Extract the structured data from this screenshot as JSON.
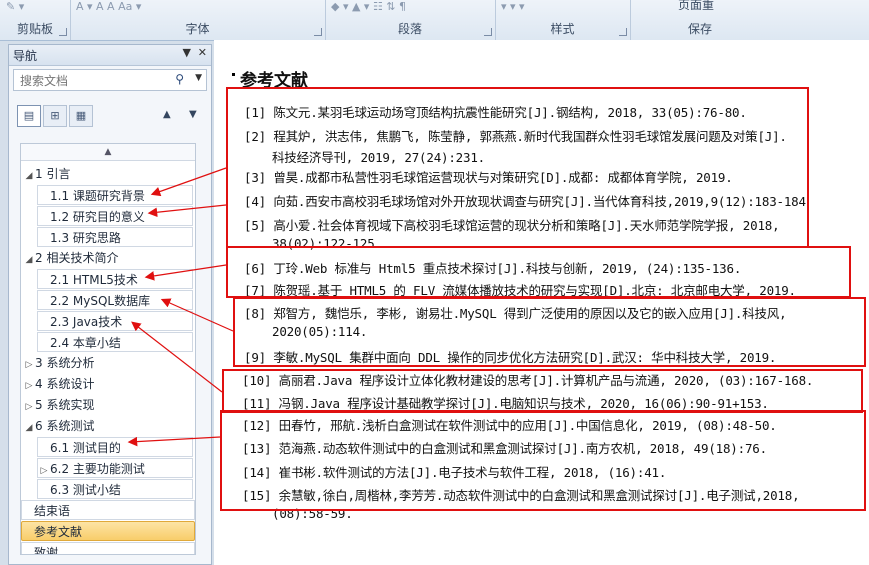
{
  "ribbon": {
    "groups": [
      {
        "label": "剪贴板",
        "icons": "✎ ▾"
      },
      {
        "label": "字体",
        "icons": "A ▾  A  A  Aa ▾"
      },
      {
        "label": "段落",
        "icons": "◆ ▾  ▲ ▾  ☷  ⇅  ¶"
      },
      {
        "label": "样式",
        "icons": "▾  ▾  ▾"
      },
      {
        "label": "页面重",
        "icons": ""
      },
      {
        "label": "保存",
        "icons": ""
      }
    ]
  },
  "nav": {
    "title": "导航",
    "search_placeholder": "搜索文档",
    "items": [
      {
        "label": "1 引言",
        "expander": "◢"
      },
      {
        "label": "1.1 课题研究背景",
        "expander": ""
      },
      {
        "label": "1.2 研究目的意义",
        "expander": ""
      },
      {
        "label": "1.3 研究思路",
        "expander": ""
      },
      {
        "label": "2 相关技术简介",
        "expander": "◢"
      },
      {
        "label": "2.1 HTML5技术",
        "expander": ""
      },
      {
        "label": "2.2 MySQL数据库",
        "expander": ""
      },
      {
        "label": "2.3 Java技术",
        "expander": ""
      },
      {
        "label": "2.4 本章小结",
        "expander": ""
      },
      {
        "label": "3 系统分析",
        "expander": "▷"
      },
      {
        "label": "4 系统设计",
        "expander": "▷"
      },
      {
        "label": "5 系统实现",
        "expander": "▷"
      },
      {
        "label": "6 系统测试",
        "expander": "◢"
      },
      {
        "label": "6.1 测试目的",
        "expander": ""
      },
      {
        "label": "6.2 主要功能测试",
        "expander": "▷"
      },
      {
        "label": "6.3 测试小结",
        "expander": ""
      },
      {
        "label": "结束语",
        "expander": ""
      },
      {
        "label": "参考文献",
        "expander": ""
      },
      {
        "label": "致谢",
        "expander": ""
      }
    ]
  },
  "doc": {
    "heading": "参考文献",
    "refs": [
      {
        "num": "[1]",
        "text": "陈文元.某羽毛球运动场穹顶结构抗震性能研究[J].钢结构, 2018, 33(05):76-80."
      },
      {
        "num": "[2]",
        "text": "程其炉, 洪志伟, 焦鹏飞, 陈莹静, 郭燕燕.新时代我国群众性羽毛球馆发展问题及对策[J].",
        "cont": "科技经济导刊, 2019, 27(24):231."
      },
      {
        "num": "[3]",
        "text": "曾昊.成都市私营性羽毛球馆运营现状与对策研究[D].成都: 成都体育学院, 2019."
      },
      {
        "num": "[4]",
        "text": "向茹.西安市高校羽毛球场馆对外开放现状调查与研究[J].当代体育科技,2019,9(12):183-184"
      },
      {
        "num": "[5]",
        "text": "高小爱.社会体育视域下高校羽毛球馆运营的现状分析和策略[J].天水师范学院学报, 2018,",
        "cont": "38(02):122-125."
      },
      {
        "num": "[6]",
        "text": "丁玲.Web 标准与 Html5 重点技术探讨[J].科技与创新, 2019, (24):135-136."
      },
      {
        "num": "[7]",
        "text": "陈贺瑶.基于 HTML5 的 FLV 流媒体播放技术的研究与实现[D].北京: 北京邮电大学, 2019."
      },
      {
        "num": "[8]",
        "text": "郑智方, 魏恺乐, 李彬, 谢易壮.MySQL 得到广泛使用的原因以及它的嵌入应用[J].科技风,",
        "cont": "2020(05):114."
      },
      {
        "num": "[9]",
        "text": "李敏.MySQL 集群中面向 DDL 操作的同步优化方法研究[D].武汉: 华中科技大学, 2019."
      },
      {
        "num": "[10]",
        "text": "高丽君.Java 程序设计立体化教材建设的思考[J].计算机产品与流通, 2020, (03):167-168."
      },
      {
        "num": "[11]",
        "text": "冯钢.Java 程序设计基础教学探讨[J].电脑知识与技术, 2020, 16(06):90-91+153."
      },
      {
        "num": "[12]",
        "text": "田春竹, 邢航.浅析白盒测试在软件测试中的应用[J].中国信息化, 2019, (08):48-50."
      },
      {
        "num": "[13]",
        "text": "范海燕.动态软件测试中的白盒测试和黑盒测试探讨[J].南方农机, 2018, 49(18):76."
      },
      {
        "num": "[14]",
        "text": "崔书彬.软件测试的方法[J].电子技术与软件工程, 2018, (16):41."
      },
      {
        "num": "[15]",
        "text": "余慧敏,徐白,周楷林,李芳芳.动态软件测试中的白盒测试和黑盒测试探讨[J].电子测试,2018,",
        "cont": "(08):58-59."
      }
    ]
  },
  "colors": {
    "annotation": "#e01010",
    "selected": "#f8cd6a"
  },
  "icons": [
    "search-icon",
    "close-icon",
    "dropdown-icon",
    "arrow-up-icon",
    "arrow-down-icon"
  ]
}
